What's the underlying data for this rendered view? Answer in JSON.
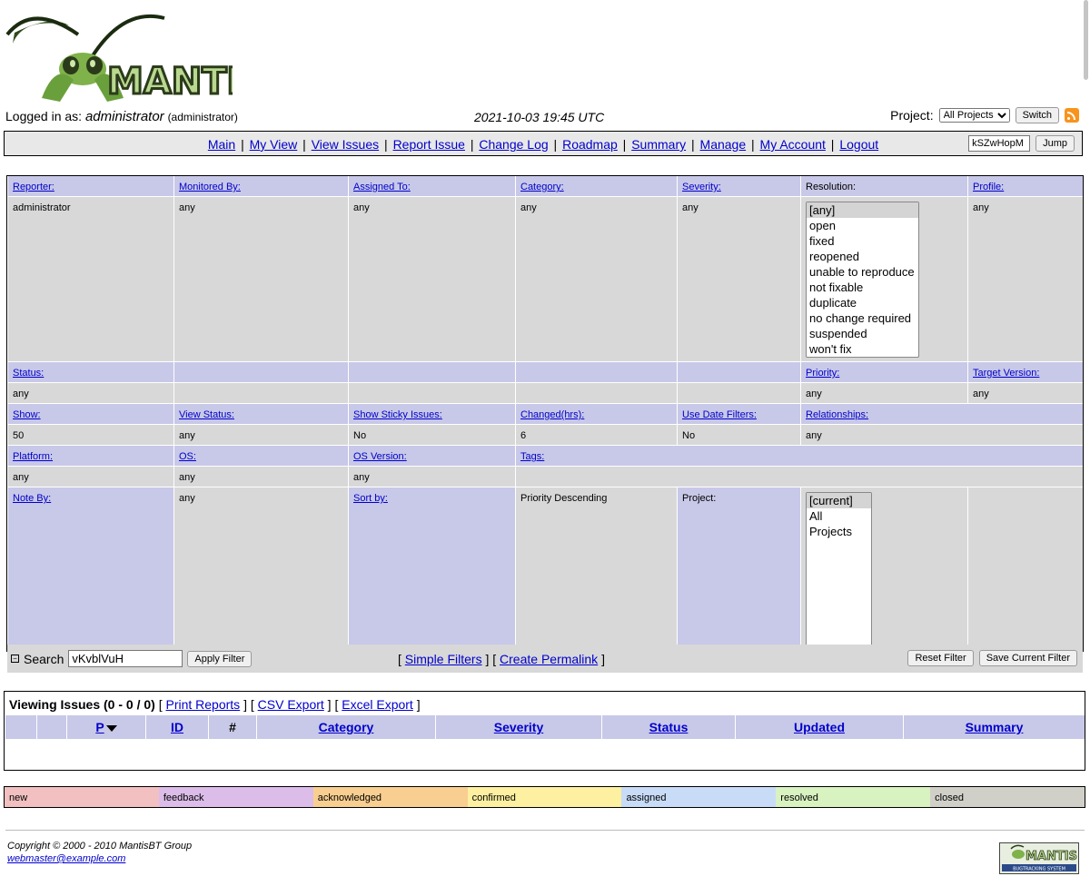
{
  "header": {
    "logo_text": "MANTIS",
    "logged_in_label": "Logged in as:",
    "username": "administrator",
    "role": "(administrator)",
    "datetime": "2021-10-03 19:45 UTC",
    "project_label": "Project:",
    "project_selected": "All Projects",
    "switch_label": "Switch"
  },
  "menu": {
    "items": [
      "Main",
      "My View",
      "View Issues",
      "Report Issue",
      "Change Log",
      "Roadmap",
      "Summary",
      "Manage",
      "My Account",
      "Logout"
    ],
    "jump_value": "kSZwHopM",
    "jump_label": "Jump"
  },
  "filters": {
    "row1_headers": [
      "Reporter:",
      "Monitored By:",
      "Assigned To:",
      "Category:",
      "Severity:",
      "Resolution:",
      "Profile:"
    ],
    "row1_values": [
      "administrator",
      "any",
      "any",
      "any",
      "any",
      "",
      "any"
    ],
    "resolution_options": [
      "[any]",
      "open",
      "fixed",
      "reopened",
      "unable to reproduce",
      "not fixable",
      "duplicate",
      "no change required",
      "suspended",
      "won't fix"
    ],
    "status_label": "Status:",
    "status_value": "any",
    "priority_label": "Priority:",
    "priority_value": "any",
    "target_label": "Target Version:",
    "target_value": "any",
    "row3_headers": [
      "Show:",
      "View Status:",
      "Show Sticky Issues:",
      "Changed(hrs):",
      "Use Date Filters:",
      "Relationships:"
    ],
    "row3_values": [
      "50",
      "any",
      "No",
      "6",
      "No",
      "any"
    ],
    "row4_headers": [
      "Platform:",
      "OS:",
      "OS Version:",
      "Tags:"
    ],
    "row4_values": [
      "any",
      "any",
      "any",
      ""
    ],
    "note_by_label": "Note By:",
    "note_by_value": "any",
    "sort_by_label": "Sort by:",
    "sort_by_value": "Priority Descending",
    "project_label": "Project:",
    "project_options": [
      "[current]",
      "All Projects"
    ],
    "search_label": "Search",
    "search_value": "vKvblVuH",
    "apply_label": "Apply Filter",
    "simple_filters": "Simple Filters",
    "create_permalink": "Create Permalink",
    "reset_label": "Reset Filter",
    "save_label": "Save Current Filter"
  },
  "issues": {
    "title": "Viewing Issues (0 - 0 / 0)",
    "links": [
      "Print Reports",
      "CSV Export",
      "Excel Export"
    ],
    "columns": [
      "",
      "",
      "P",
      "ID",
      "#",
      "Category",
      "Severity",
      "Status",
      "Updated",
      "Summary"
    ]
  },
  "legend": [
    {
      "label": "new",
      "color": "#f2c0c0"
    },
    {
      "label": "feedback",
      "color": "#dcbce8"
    },
    {
      "label": "acknowledged",
      "color": "#f8cf90"
    },
    {
      "label": "confirmed",
      "color": "#fdf0a0"
    },
    {
      "label": "assigned",
      "color": "#c8dcf8"
    },
    {
      "label": "resolved",
      "color": "#d8f2c0"
    },
    {
      "label": "closed",
      "color": "#d0d0c8"
    }
  ],
  "footer": {
    "copyright": "Copyright © 2000 - 2010 MantisBT Group",
    "email": "webmaster@example.com",
    "powered_text": "MANTIS",
    "powered_sub": "BUGTRACKING SYSTEM"
  }
}
